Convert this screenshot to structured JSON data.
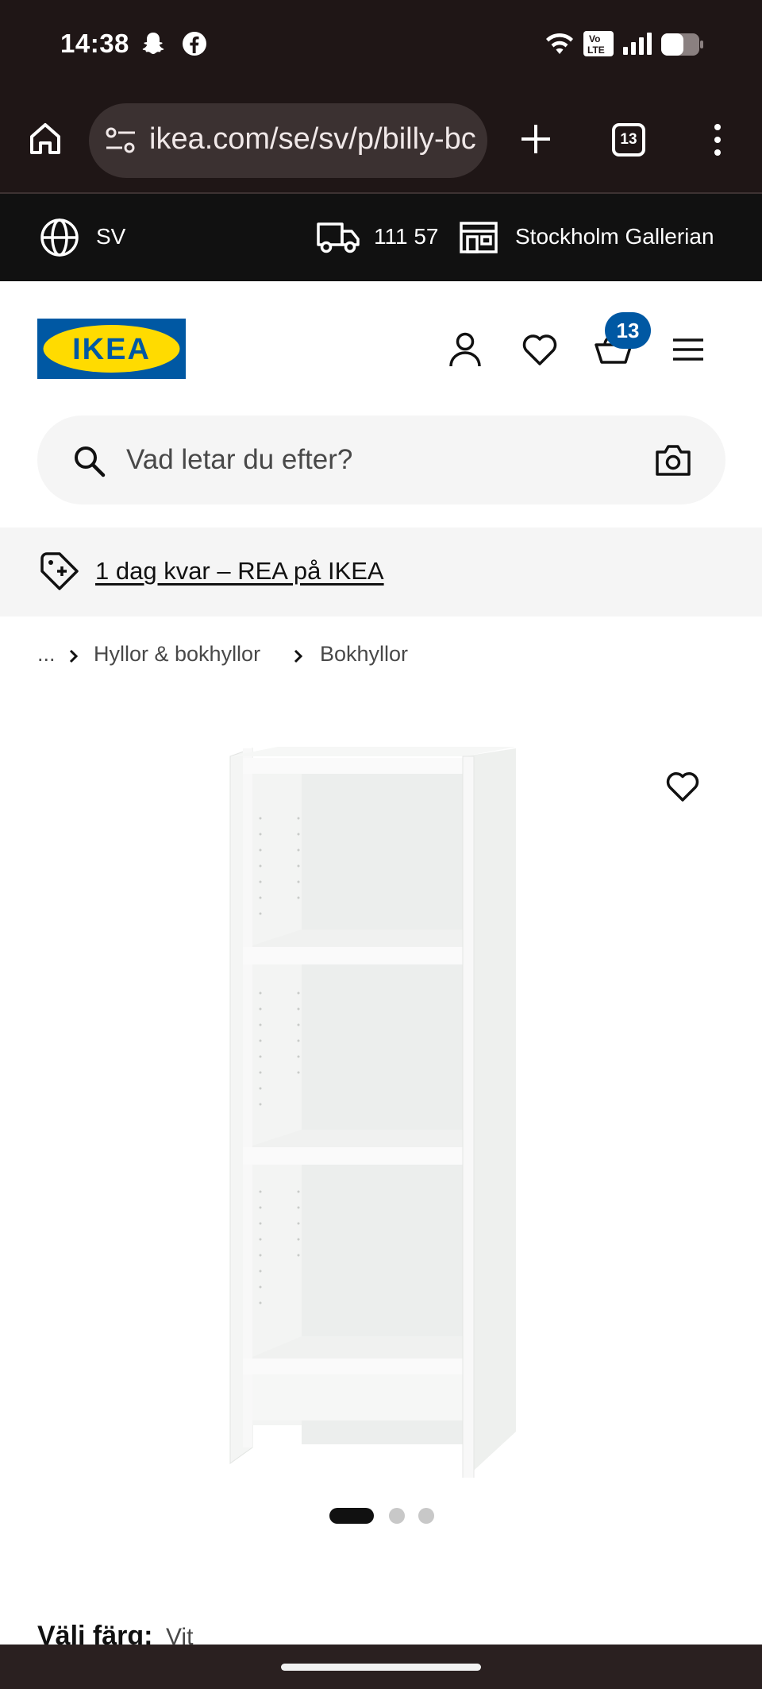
{
  "status_bar": {
    "time": "14:38",
    "icons": [
      "snapchat-icon",
      "facebook-icon",
      "wifi-icon",
      "volte-icon",
      "signal-icon",
      "battery-icon"
    ],
    "volte_label_top": "Vo",
    "volte_label_bottom": "LTE"
  },
  "browser": {
    "url": "ikea.com/se/sv/p/billy-bc",
    "tab_count": "13",
    "icons": [
      "home-icon",
      "site-settings-icon",
      "new-tab-icon",
      "tabs-icon",
      "more-icon"
    ]
  },
  "top_strip": {
    "language": "SV",
    "postal_code": "111 57",
    "store": "Stockholm Gallerian"
  },
  "header": {
    "logo_text": "IKEA",
    "cart_count": "13",
    "icons": [
      "account-icon",
      "favorites-icon",
      "cart-icon",
      "menu-icon"
    ]
  },
  "search": {
    "placeholder": "Vad letar du efter?"
  },
  "promo": {
    "text": "1 dag kvar – REA på IKEA"
  },
  "breadcrumb": {
    "items": [
      "...",
      "Hyllor & bokhyllor",
      "Bokhyllor"
    ]
  },
  "gallery": {
    "image_alt": "BILLY bookcase white",
    "dot_count": 3,
    "active_index": 0
  },
  "color": {
    "label": "Välj färg:",
    "value": "Vit"
  },
  "colors": {
    "dark_bg": "#1f1616",
    "ikea_blue": "#0058a3",
    "ikea_yellow": "#ffdb00"
  }
}
